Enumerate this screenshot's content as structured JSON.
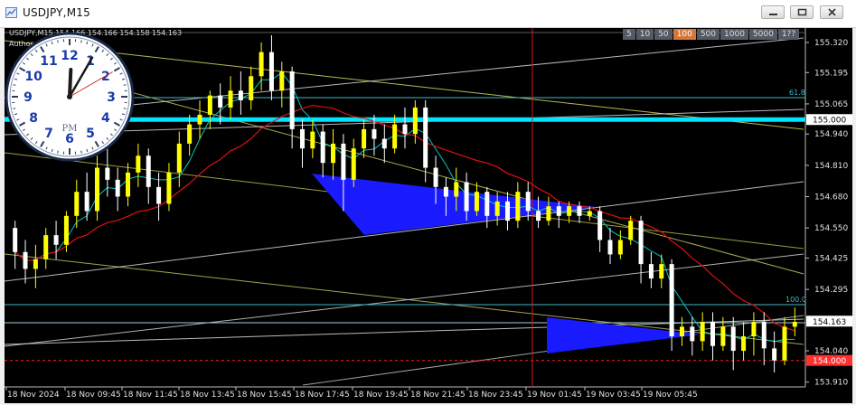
{
  "window": {
    "title": "USDJPY,M15",
    "minimize_icon": "minimize-icon",
    "maximize_icon": "restore-icon",
    "close_icon": "close-icon"
  },
  "chart_header": {
    "symbol_line": "USDJPY,M15 154.166 154.166 154.158 154.163",
    "indicator_line": "Author: GogoJungle"
  },
  "timeframes": [
    "5",
    "10",
    "50",
    "100",
    "500",
    "1000",
    "5000",
    "1??"
  ],
  "active_timeframe": "100",
  "clock": {
    "numbers": [
      "12",
      "1",
      "2",
      "3",
      "4",
      "5",
      "6",
      "7",
      "8",
      "9",
      "10",
      "11"
    ],
    "period": "PM",
    "hour": 12,
    "minute": 5
  },
  "price_axis": {
    "labels": [
      "155.320",
      "155.195",
      "155.065",
      "154.940",
      "154.810",
      "154.680",
      "154.550",
      "154.425",
      "154.295",
      "154.040",
      "153.910"
    ],
    "current_price": "154.163",
    "level_155": "155.000",
    "level_154": "154.000",
    "fib_618": "61.8",
    "fib_100": "100.0"
  },
  "time_axis": {
    "labels": [
      "18 Nov 2024",
      "18 Nov 09:45",
      "18 Nov 11:45",
      "18 Nov 13:45",
      "18 Nov 15:45",
      "18 Nov 17:45",
      "18 Nov 19:45",
      "18 Nov 21:45",
      "18 Nov 23:45",
      "19 Nov 01:45",
      "19 Nov 03:45",
      "19 Nov 05:45"
    ]
  },
  "colors": {
    "background": "#000000",
    "bull_candle": "#ffff00",
    "bear_candle": "#ffffff",
    "level_line": "#00e5ff",
    "triangle_fill": "#1a1aff",
    "ma_red": "#e01010",
    "ma_cyan": "#00c8c8",
    "trend_line": "#d8d860",
    "red_dashed": "#ff2020",
    "cursor_line": "#c81e1e"
  },
  "chart_data": {
    "type": "candlestick",
    "symbol": "USDJPY",
    "timeframe": "M15",
    "ylim": [
      153.89,
      155.38
    ],
    "x_labels": [
      "18 Nov 2024",
      "18 Nov 09:45",
      "18 Nov 11:45",
      "18 Nov 13:45",
      "18 Nov 15:45",
      "18 Nov 17:45",
      "18 Nov 19:45",
      "18 Nov 21:45",
      "18 Nov 23:45",
      "19 Nov 01:45",
      "19 Nov 03:45",
      "19 Nov 05:45"
    ],
    "candles": [
      [
        154.55,
        154.45,
        154.58,
        154.38
      ],
      [
        154.45,
        154.38,
        154.5,
        154.32
      ],
      [
        154.38,
        154.42,
        154.48,
        154.3
      ],
      [
        154.42,
        154.52,
        154.55,
        154.38
      ],
      [
        154.52,
        154.48,
        154.58,
        154.42
      ],
      [
        154.48,
        154.6,
        154.62,
        154.45
      ],
      [
        154.6,
        154.7,
        154.75,
        154.55
      ],
      [
        154.7,
        154.62,
        154.78,
        154.58
      ],
      [
        154.62,
        154.8,
        154.85,
        154.58
      ],
      [
        154.8,
        154.75,
        154.88,
        154.68
      ],
      [
        154.75,
        154.68,
        154.8,
        154.62
      ],
      [
        154.68,
        154.78,
        154.82,
        154.64
      ],
      [
        154.78,
        154.85,
        154.9,
        154.72
      ],
      [
        154.85,
        154.72,
        154.88,
        154.65
      ],
      [
        154.72,
        154.65,
        154.78,
        154.58
      ],
      [
        154.65,
        154.78,
        154.82,
        154.62
      ],
      [
        154.78,
        154.9,
        154.95,
        154.72
      ],
      [
        154.9,
        154.98,
        155.02,
        154.85
      ],
      [
        154.98,
        155.02,
        155.08,
        154.92
      ],
      [
        155.02,
        155.1,
        155.12,
        154.96
      ],
      [
        155.1,
        155.05,
        155.15,
        154.98
      ],
      [
        155.05,
        155.12,
        155.18,
        155.0
      ],
      [
        155.12,
        155.08,
        155.2,
        155.02
      ],
      [
        155.08,
        155.18,
        155.22,
        155.04
      ],
      [
        155.18,
        155.28,
        155.32,
        155.12
      ],
      [
        155.28,
        155.12,
        155.35,
        155.08
      ],
      [
        155.12,
        155.2,
        155.24,
        155.05
      ],
      [
        155.2,
        154.96,
        155.22,
        154.88
      ],
      [
        154.96,
        154.88,
        155.0,
        154.8
      ],
      [
        154.88,
        154.95,
        155.0,
        154.84
      ],
      [
        154.95,
        154.82,
        154.98,
        154.76
      ],
      [
        154.82,
        154.9,
        154.96,
        154.75
      ],
      [
        154.9,
        154.75,
        154.94,
        154.62
      ],
      [
        154.75,
        154.88,
        154.92,
        154.72
      ],
      [
        154.88,
        154.96,
        155.0,
        154.84
      ],
      [
        154.96,
        154.92,
        155.02,
        154.85
      ],
      [
        154.92,
        154.88,
        154.98,
        154.82
      ],
      [
        154.88,
        154.98,
        155.02,
        154.86
      ],
      [
        154.98,
        154.94,
        155.05,
        154.88
      ],
      [
        154.94,
        155.05,
        155.08,
        154.9
      ],
      [
        155.05,
        154.8,
        155.08,
        154.74
      ],
      [
        154.8,
        154.72,
        154.85,
        154.65
      ],
      [
        154.72,
        154.68,
        154.76,
        154.6
      ],
      [
        154.68,
        154.74,
        154.8,
        154.62
      ],
      [
        154.74,
        154.62,
        154.78,
        154.58
      ],
      [
        154.62,
        154.7,
        154.74,
        154.6
      ],
      [
        154.7,
        154.6,
        154.72,
        154.55
      ],
      [
        154.6,
        154.66,
        154.7,
        154.56
      ],
      [
        154.66,
        154.58,
        154.7,
        154.54
      ],
      [
        154.58,
        154.7,
        154.74,
        154.55
      ],
      [
        154.7,
        154.62,
        154.74,
        154.58
      ],
      [
        154.62,
        154.58,
        154.68,
        154.55
      ],
      [
        154.58,
        154.64,
        154.68,
        154.56
      ],
      [
        154.64,
        154.6,
        154.66,
        154.55
      ],
      [
        154.6,
        154.64,
        154.66,
        154.57
      ],
      [
        154.64,
        154.6,
        154.66,
        154.57
      ],
      [
        154.6,
        154.62,
        154.64,
        154.58
      ],
      [
        154.62,
        154.5,
        154.64,
        154.45
      ],
      [
        154.5,
        154.44,
        154.55,
        154.4
      ],
      [
        154.44,
        154.5,
        154.54,
        154.42
      ],
      [
        154.5,
        154.58,
        154.6,
        154.48
      ],
      [
        154.58,
        154.4,
        154.6,
        154.32
      ],
      [
        154.4,
        154.34,
        154.45,
        154.3
      ],
      [
        154.34,
        154.4,
        154.44,
        154.3
      ],
      [
        154.4,
        154.1,
        154.42,
        154.04
      ],
      [
        154.1,
        154.14,
        154.18,
        154.06
      ],
      [
        154.14,
        154.08,
        154.18,
        154.02
      ],
      [
        154.08,
        154.16,
        154.2,
        154.04
      ],
      [
        154.16,
        154.06,
        154.2,
        154.0
      ],
      [
        154.06,
        154.14,
        154.18,
        154.04
      ],
      [
        154.14,
        154.04,
        154.18,
        153.96
      ],
      [
        154.04,
        154.1,
        154.16,
        154.0
      ],
      [
        154.1,
        154.16,
        154.2,
        154.02
      ],
      [
        154.16,
        154.05,
        154.2,
        153.98
      ],
      [
        154.05,
        154.0,
        154.12,
        153.95
      ],
      [
        154.0,
        154.14,
        154.18,
        153.98
      ],
      [
        154.14,
        154.16,
        154.22,
        154.1
      ]
    ],
    "horizontal_levels": [
      155.0,
      154.0
    ],
    "fibonacci": [
      {
        "label": "61.8"
      },
      {
        "label": "100.0"
      }
    ],
    "current_price": 154.163
  }
}
